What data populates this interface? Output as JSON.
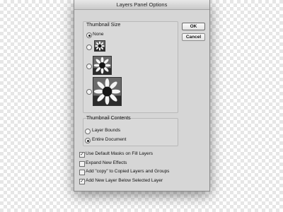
{
  "dialog": {
    "title": "Layers Panel Options",
    "ok_label": "OK",
    "cancel_label": "Cancel"
  },
  "thumbnail_size": {
    "label": "Thumbnail Size",
    "none_label": "None",
    "selected": "None"
  },
  "thumbnail_contents": {
    "label": "Thumbnail Contents",
    "options": [
      "Layer Bounds",
      "Entire Document"
    ],
    "selected": "Entire Document"
  },
  "checkboxes": [
    {
      "label": "Use Default Masks on Fill Layers",
      "checked": true
    },
    {
      "label": "Expand New Effects",
      "checked": false
    },
    {
      "label": "Add \"copy\" to Copied Layers and Groups",
      "checked": false
    },
    {
      "label": "Add New Layer Below Selected Layer",
      "checked": true
    }
  ],
  "icons": {
    "check_glyph": "✓",
    "preview_image": "sunflower-icon"
  }
}
